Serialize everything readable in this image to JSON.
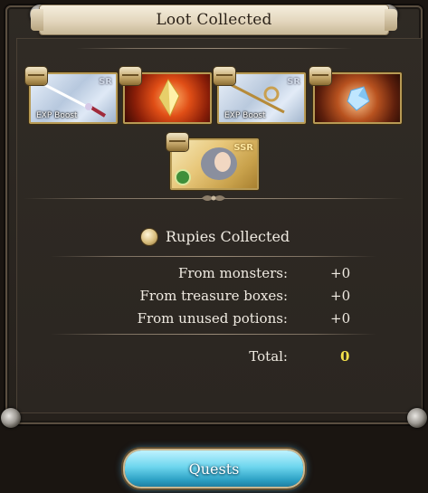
{
  "window": {
    "title": "Loot Collected"
  },
  "loot_items": [
    {
      "name": "weapon-sword",
      "rarity": "SR",
      "label": "EXP Boost"
    },
    {
      "name": "fire-quartz",
      "rarity": "",
      "label": ""
    },
    {
      "name": "weapon-scepter",
      "rarity": "SR",
      "label": "EXP Boost"
    },
    {
      "name": "water-quartz",
      "rarity": "",
      "label": ""
    },
    {
      "name": "summon-ssr",
      "rarity": "SSR",
      "label": ""
    }
  ],
  "rupies": {
    "heading": "Rupies Collected",
    "rows": [
      {
        "label": "From monsters:",
        "value": "+0"
      },
      {
        "label": "From treasure boxes:",
        "value": "+0"
      },
      {
        "label": "From unused potions:",
        "value": "+0"
      }
    ],
    "total_label": "Total:",
    "total_value": "0"
  },
  "button": {
    "label": "Quests"
  },
  "colors": {
    "accent_gold": "#b79a55",
    "total_value": "#f4e04a",
    "button_blue": "#6ed6ee"
  }
}
